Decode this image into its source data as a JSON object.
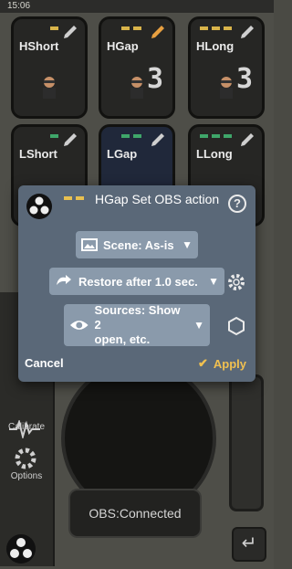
{
  "status_bar": {
    "time": "15:06"
  },
  "pads": [
    {
      "name": "HShort",
      "indicator_color": "#d9b44a",
      "indicator_count": 1
    },
    {
      "name": "HGap",
      "indicator_color": "#d9b44a",
      "indicator_count": 2
    },
    {
      "name": "HLong",
      "indicator_color": "#d9b44a",
      "indicator_count": 3
    },
    {
      "name": "LShort",
      "indicator_color": "#3fa66a",
      "indicator_count": 1
    },
    {
      "name": "LGap",
      "indicator_color": "#3fa66a",
      "indicator_count": 2
    },
    {
      "name": "LLong",
      "indicator_color": "#3fa66a",
      "indicator_count": 3
    }
  ],
  "sidebar": {
    "calibrate_label": "Calibrate",
    "options_label": "Options"
  },
  "obs_status": "OBS:Connected",
  "dialog": {
    "title": "HGap Set OBS action",
    "scene_label": "Scene: As-is",
    "restore_label": "Restore after 1.0 sec.",
    "sources_label_line1": "Sources: Show 2",
    "sources_label_line2": "open, etc.",
    "cancel_label": "Cancel",
    "apply_label": "Apply"
  },
  "colors": {
    "dialog_bg": "#5a6878",
    "pill_bg": "#8a9aab",
    "accent_yellow": "#f0c050",
    "accent_green": "#3fa66a"
  }
}
